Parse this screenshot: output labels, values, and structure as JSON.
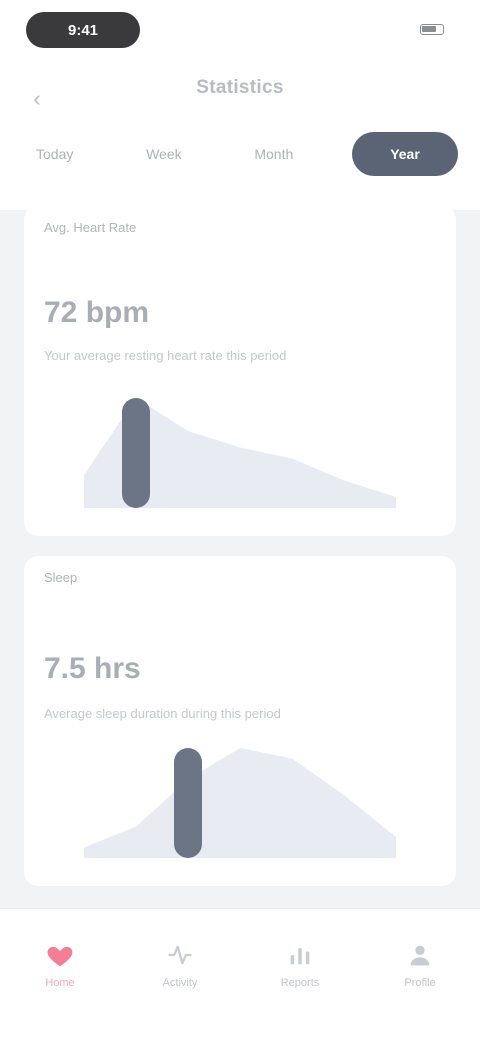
{
  "status_bar": {
    "time": "9:41"
  },
  "header": {
    "title": "Statistics",
    "back_glyph": "‹"
  },
  "tabs": [
    {
      "label": "Today"
    },
    {
      "label": "Week"
    },
    {
      "label": "Month"
    },
    {
      "label": "Year"
    }
  ],
  "cards": [
    {
      "label": "Avg. Heart Rate",
      "value": "72 bpm",
      "subtitle": "Your average resting heart rate this period",
      "chart_data": {
        "type": "area",
        "x": [
          0,
          1,
          2,
          3,
          4,
          5,
          6
        ],
        "y": [
          12,
          40,
          28,
          22,
          18,
          10,
          4
        ],
        "highlight_index": 1
      }
    },
    {
      "label": "Sleep",
      "value": "7.5 hrs",
      "subtitle": "Average sleep duration during this period",
      "chart_data": {
        "type": "area",
        "x": [
          0,
          1,
          2,
          3,
          4,
          5,
          6
        ],
        "y": [
          4,
          12,
          30,
          42,
          38,
          24,
          8
        ],
        "highlight_index": 2
      }
    }
  ],
  "tabbar": [
    {
      "label": "Home",
      "icon": "heart-icon",
      "active": true
    },
    {
      "label": "Activity",
      "icon": "activity-icon",
      "active": false
    },
    {
      "label": "Reports",
      "icon": "chart-icon",
      "active": false
    },
    {
      "label": "Profile",
      "icon": "user-icon",
      "active": false
    }
  ],
  "colors": {
    "accent": "#5a6475",
    "active_tab_icon": "#f47e96"
  }
}
